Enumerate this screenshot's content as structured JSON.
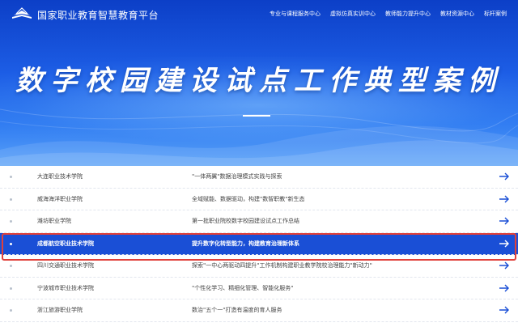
{
  "header": {
    "platform_title": "国家职业教育智慧教育平台",
    "nav": [
      "专业与课程服务中心",
      "虚拟仿真实训中心",
      "教师能力提升中心",
      "教材资源中心",
      "标杆案例"
    ]
  },
  "hero": {
    "title": "数字校园建设试点工作典型案例"
  },
  "cases": [
    {
      "school": "大连职业技术学院",
      "topic": "\"一体两翼\"数据治理模式实践与探索",
      "active": false
    },
    {
      "school": "威海海洋职业学院",
      "topic": "全域赋能、数据驱动，构建\"数智职教\"新生态",
      "active": false
    },
    {
      "school": "潍坊职业学院",
      "topic": "第一批职业院校数字校园建设试点工作总结",
      "active": false
    },
    {
      "school": "成都航空职业技术学院",
      "topic": "提升数字化转型能力，构建教育治理新体系",
      "active": true
    },
    {
      "school": "四川交通职业技术学院",
      "topic": "探索\"一中心两驱动四提升\"工作机制构建职业教学院校治理能力\"新动力\"",
      "active": false
    },
    {
      "school": "宁波城市职业技术学院",
      "topic": "\"个性化学习、精细化管理、智能化服务\"",
      "active": false
    },
    {
      "school": "浙江旅游职业学院",
      "topic": "数治\"五个一\"打造有温度的育人服务",
      "active": false
    }
  ],
  "colors": {
    "hero_top": "#0c3fc7",
    "hero_bottom": "#5aa2f8",
    "active_row": "#1a4fd6",
    "highlight_border": "#e0403a",
    "arrow": "#1a4fd6"
  },
  "icons": {
    "logo": "book-logo-icon",
    "row_link": "arrow-right-icon"
  }
}
